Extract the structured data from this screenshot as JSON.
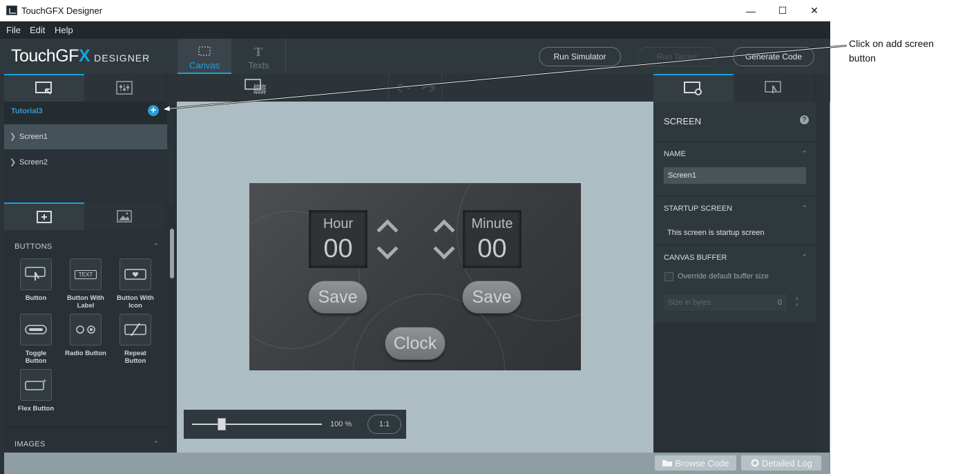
{
  "window": {
    "title": "TouchGFX Designer",
    "minimize": "—",
    "maximize": "☐",
    "close": "✕"
  },
  "menu": [
    "File",
    "Edit",
    "Help"
  ],
  "logo": {
    "main": "TouchGF",
    "x": "X",
    "sub": "DESIGNER"
  },
  "header_tabs": [
    {
      "label": "Canvas",
      "active": true
    },
    {
      "label": "Texts",
      "active": false
    }
  ],
  "header_buttons": {
    "run_simulator": "Run Simulator",
    "run_target": "Run Target",
    "generate_code": "Generate Code"
  },
  "project": {
    "name": "Tutorial3",
    "add": "+"
  },
  "screens": [
    {
      "label": "Screen1",
      "selected": true
    },
    {
      "label": "Screen2",
      "selected": false
    }
  ],
  "widgets": {
    "sections": {
      "buttons": "BUTTONS",
      "images": "IMAGES"
    },
    "items": [
      {
        "label": "Button",
        "icon": "button-icon"
      },
      {
        "label": "Button With Label",
        "icon": "text-button-icon",
        "glyph": "TEXT"
      },
      {
        "label": "Button With Icon",
        "icon": "icon-button-icon"
      },
      {
        "label": "Toggle Button",
        "icon": "toggle-button-icon"
      },
      {
        "label": "Radio Button",
        "icon": "radio-button-icon"
      },
      {
        "label": "Repeat Button",
        "icon": "repeat-button-icon"
      },
      {
        "label": "Flex Button",
        "icon": "flex-button-icon"
      }
    ]
  },
  "screen_preview": {
    "hour_label": "Hour",
    "hour_value": "00",
    "minute_label": "Minute",
    "minute_value": "00",
    "save_label": "Save",
    "clock_label": "Clock"
  },
  "zoom": {
    "value": "100 %",
    "reset": "1:1",
    "level": 0.2
  },
  "properties": {
    "title": "SCREEN",
    "help": "?",
    "name_header": "NAME",
    "name_value": "Screen1",
    "startup_header": "STARTUP SCREEN",
    "startup_text": "This screen is startup screen",
    "buffer_header": "CANVAS BUFFER",
    "buffer_checkbox": "Override default buffer size",
    "size_placeholder": "Size in bytes",
    "size_value": "0"
  },
  "bottom_buttons": {
    "browse": "Browse Code",
    "log": "Detailed Log"
  },
  "annotation": {
    "text": "Click on add screen button"
  },
  "colors": {
    "accent": "#1aa0e0",
    "canvas_bg": "#adbdc4",
    "panel_bg": "#2a3136"
  }
}
